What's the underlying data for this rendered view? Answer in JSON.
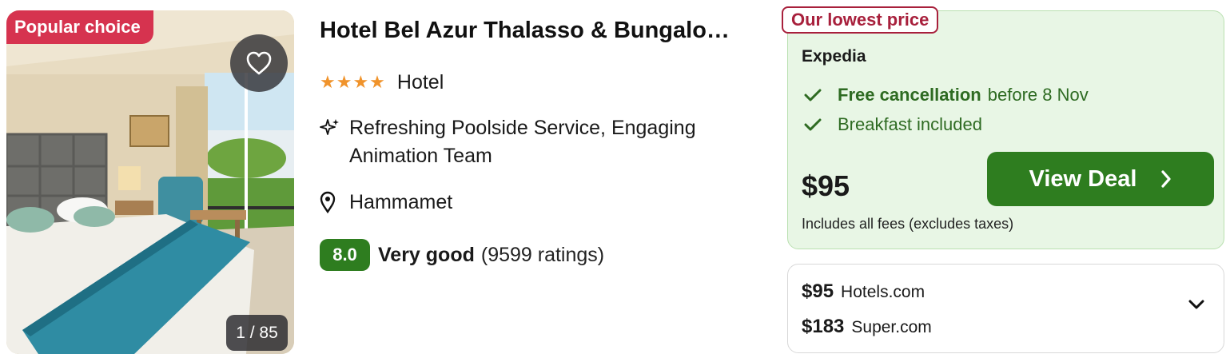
{
  "photo": {
    "badge": "Popular choice",
    "counter": "1 / 85",
    "favorite_icon": "heart-icon"
  },
  "hotel": {
    "name": "Hotel Bel Azur Thalasso & Bungalo…",
    "stars": "★★★★",
    "star_count": 4,
    "type": "Hotel",
    "highlights": "Refreshing Poolside Service, Engaging Animation Team",
    "location": "Hammamet",
    "rating": {
      "score": "8.0",
      "label": "Very good",
      "count": "(9599 ratings)"
    }
  },
  "deal": {
    "badge": "Our lowest price",
    "provider": "Expedia",
    "perks": [
      {
        "strong": "Free cancellation",
        "rest": "before 8 Nov"
      },
      {
        "strong": "",
        "rest": "Breakfast included"
      }
    ],
    "price": "$95",
    "fees_note": "Includes all fees (excludes taxes)",
    "button_label": "View Deal"
  },
  "other_offers": [
    {
      "price": "$95",
      "provider": "Hotels.com"
    },
    {
      "price": "$183",
      "provider": "Super.com"
    }
  ],
  "colors": {
    "popular_badge": "#d6334f",
    "lowest_badge": "#a8203c",
    "green": "#2e7d1f",
    "deal_bg": "#e8f6e5",
    "stars": "#f0932b"
  }
}
